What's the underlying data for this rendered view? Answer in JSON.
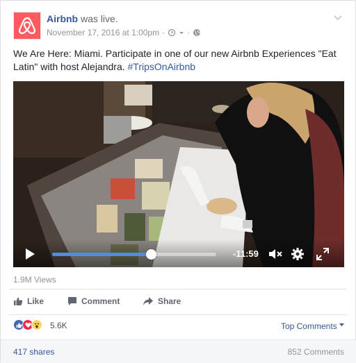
{
  "post": {
    "page_name": "Airbnb",
    "live_text": "was live.",
    "timestamp": "November 17, 2016 at 1:00pm",
    "meta_separator": "·",
    "text_main": "We Are Here: Miami. Participate in one of our new Airbnb Experiences \"Eat Latin\" with host Alejandra. ",
    "hashtag": "#TripsOnAirbnb"
  },
  "video": {
    "progress": 0.6,
    "time_remaining": "-11:59",
    "icons": [
      "play-icon",
      "mute-icon",
      "settings-icon",
      "fullscreen-icon"
    ]
  },
  "stats": {
    "views": "1.9M Views",
    "reaction_count": "5.6K",
    "top_comments": "Top Comments",
    "shares": "417 shares",
    "comments": "852 Comments"
  },
  "actions": {
    "like": "Like",
    "comment": "Comment",
    "share": "Share"
  },
  "colors": {
    "brand": "#ff5a5f",
    "link": "#365899",
    "progress": "#4a90e2"
  }
}
